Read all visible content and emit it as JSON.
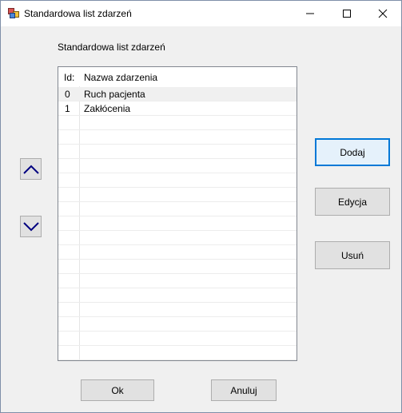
{
  "window": {
    "title": "Standardowa list zdarzeń",
    "icons": {
      "app": "app-form-icon",
      "minimize": "minimize-icon",
      "maximize": "maximize-icon",
      "close": "close-icon"
    }
  },
  "form": {
    "label": "Standardowa list zdarzeń"
  },
  "list": {
    "columns": [
      "Id:",
      "Nazwa zdarzenia"
    ],
    "rows": [
      {
        "id": "0",
        "name": "Ruch pacjenta",
        "selected": true
      },
      {
        "id": "1",
        "name": "Zakłócenia",
        "selected": false
      }
    ]
  },
  "buttons": {
    "add": "Dodaj",
    "edit": "Edycja",
    "delete": "Usuń",
    "ok": "Ok",
    "cancel": "Anuluj",
    "move_up_icon": "chevron-up-icon",
    "move_down_icon": "chevron-down-icon"
  },
  "colors": {
    "accent": "#0078d7",
    "arrow": "#000080"
  }
}
